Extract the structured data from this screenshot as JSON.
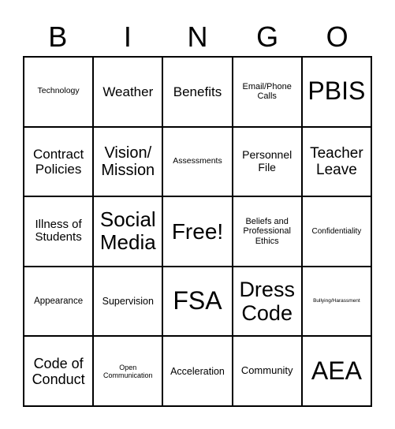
{
  "header": {
    "letters": [
      "B",
      "I",
      "N",
      "G",
      "O"
    ]
  },
  "board": {
    "rows": [
      [
        "Technology",
        "Weather",
        "Benefits",
        "Email/Phone Calls",
        "PBIS"
      ],
      [
        "Contract Policies",
        "Vision/ Mission",
        "Assessments",
        "Personnel File",
        "Teacher Leave"
      ],
      [
        "Illness of Students",
        "Social Media",
        "Free!",
        "Beliefs and Professional Ethics",
        "Confidentiality"
      ],
      [
        "Appearance",
        "Supervision",
        "FSA",
        "Dress Code",
        "Bullying/Harassment"
      ],
      [
        "Code of Conduct",
        "Open Communication",
        "Acceleration",
        "Community",
        "AEA"
      ]
    ]
  }
}
